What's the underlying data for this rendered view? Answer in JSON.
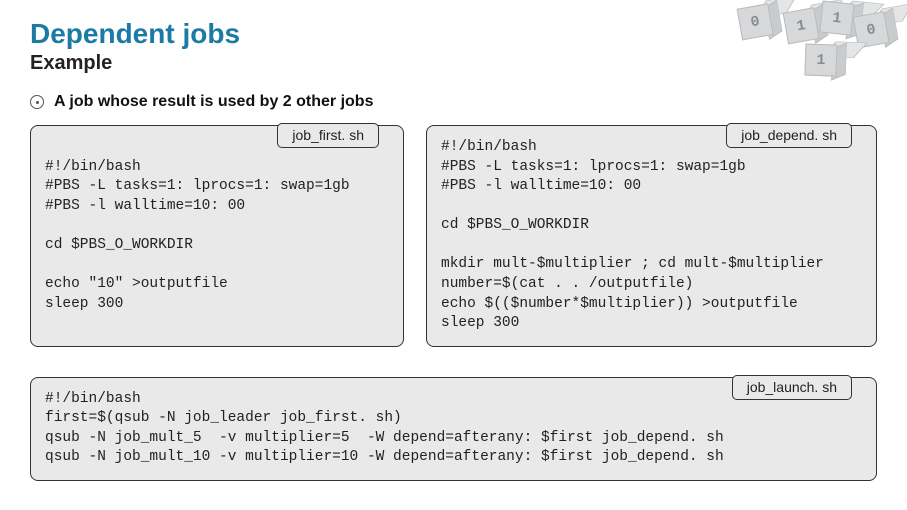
{
  "title": "Dependent jobs",
  "subtitle": "Example",
  "bullet": "A job whose result is used by 2 other jobs",
  "box_first": {
    "filename": "job_first. sh",
    "code": "\n#!/bin/bash\n#PBS -L tasks=1: lprocs=1: swap=1gb\n#PBS -l walltime=10: 00\n\ncd $PBS_O_WORKDIR\n\necho \"10\" >outputfile\nsleep 300"
  },
  "box_depend": {
    "filename": "job_depend. sh",
    "code": "#!/bin/bash\n#PBS -L tasks=1: lprocs=1: swap=1gb\n#PBS -l walltime=10: 00\n\ncd $PBS_O_WORKDIR\n\nmkdir mult-$multiplier ; cd mult-$multiplier\nnumber=$(cat . . /outputfile)\necho $(($number*$multiplier)) >outputfile\nsleep 300"
  },
  "box_launch": {
    "filename": "job_launch. sh",
    "code": "#!/bin/bash\nfirst=$(qsub -N job_leader job_first. sh)\nqsub -N job_mult_5  -v multiplier=5  -W depend=afterany: $first job_depend. sh\nqsub -N job_mult_10 -v multiplier=10 -W depend=afterany: $first job_depend. sh"
  },
  "cubes": [
    "0",
    "1",
    "1",
    "0",
    "1"
  ]
}
